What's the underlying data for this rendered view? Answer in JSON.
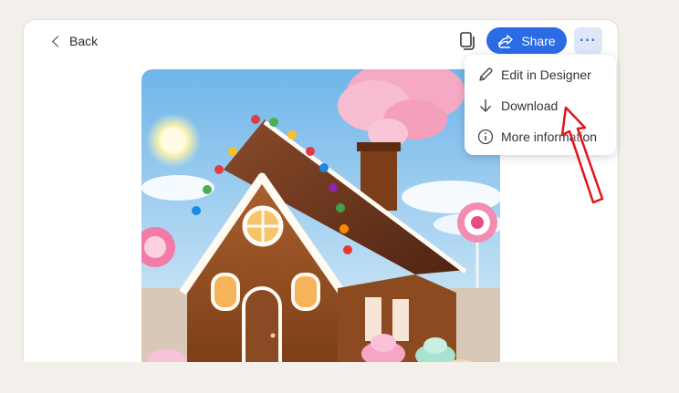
{
  "header": {
    "back_label": "Back",
    "share_label": "Share",
    "more_label": "···"
  },
  "menu": {
    "items": [
      {
        "label": "Edit in Designer",
        "icon": "pencil-icon"
      },
      {
        "label": "Download",
        "icon": "download-icon"
      },
      {
        "label": "More information",
        "icon": "info-icon"
      }
    ]
  },
  "colors": {
    "accent": "#2b6be6",
    "annotation": "#e3141b"
  },
  "image": {
    "subject": "gingerbread-house"
  }
}
